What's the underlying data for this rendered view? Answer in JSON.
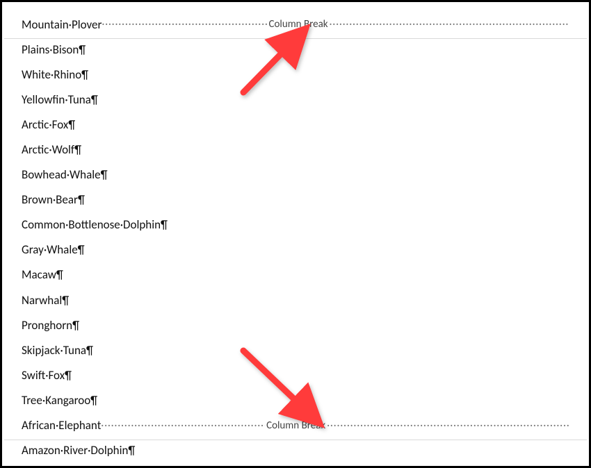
{
  "doc": {
    "lines": [
      {
        "type": "break",
        "text": "Mountain·Plover",
        "break_label": "Column Break"
      },
      {
        "type": "para",
        "text": "Plains·Bison¶"
      },
      {
        "type": "para",
        "text": "White·Rhino¶"
      },
      {
        "type": "para",
        "text": "Yellowfin·Tuna¶"
      },
      {
        "type": "para",
        "text": "Arctic·Fox¶"
      },
      {
        "type": "para",
        "text": "Arctic·Wolf¶"
      },
      {
        "type": "para",
        "text": "Bowhead·Whale¶"
      },
      {
        "type": "para",
        "text": "Brown·Bear¶"
      },
      {
        "type": "para",
        "text": "Common·Bottlenose·Dolphin¶"
      },
      {
        "type": "para",
        "text": "Gray·Whale¶"
      },
      {
        "type": "para",
        "text": "Macaw¶"
      },
      {
        "type": "para",
        "text": "Narwhal¶"
      },
      {
        "type": "para",
        "text": "Pronghorn¶"
      },
      {
        "type": "para",
        "text": "Skipjack·Tuna¶"
      },
      {
        "type": "para",
        "text": "Swift·Fox¶"
      },
      {
        "type": "para",
        "text": "Tree·Kangaroo¶"
      },
      {
        "type": "break",
        "text": "African·Elephant",
        "break_label": "Column Break"
      },
      {
        "type": "para",
        "text": "Amazon·River·Dolphin¶"
      }
    ]
  },
  "annotation": {
    "arrow_color": "#ff3b3b"
  }
}
